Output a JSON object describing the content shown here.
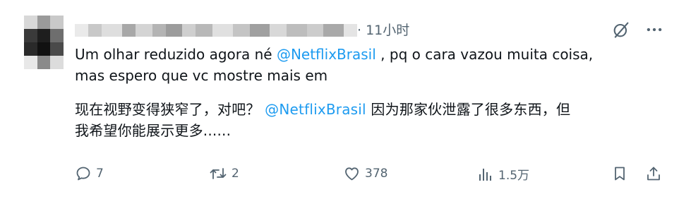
{
  "tweet": {
    "time": "· 11小时",
    "original": {
      "line1_prefix": "Um olhar reduzido agora né ",
      "line1_mention": "@NetflixBrasil",
      "line1_suffix": " , pq o cara vazou muita coisa,",
      "line2": "mas espero que vc mostre mais em"
    },
    "translation": {
      "line1_prefix": "现在视野变得狭窄了，对吧？ ",
      "line1_mention": "@NetflixBrasil",
      "line1_suffix": " 因为那家伙泄露了很多东西，但",
      "line2": "我希望你能展示更多......"
    },
    "actions": {
      "replies": "7",
      "retweets": "2",
      "likes": "378",
      "views": "1.5万"
    },
    "icons": {
      "top": [
        "grok-slash-icon",
        "more-icon"
      ],
      "actions": [
        "reply-icon",
        "retweet-icon",
        "like-icon",
        "views-icon",
        "bookmark-icon",
        "share-icon"
      ]
    }
  }
}
